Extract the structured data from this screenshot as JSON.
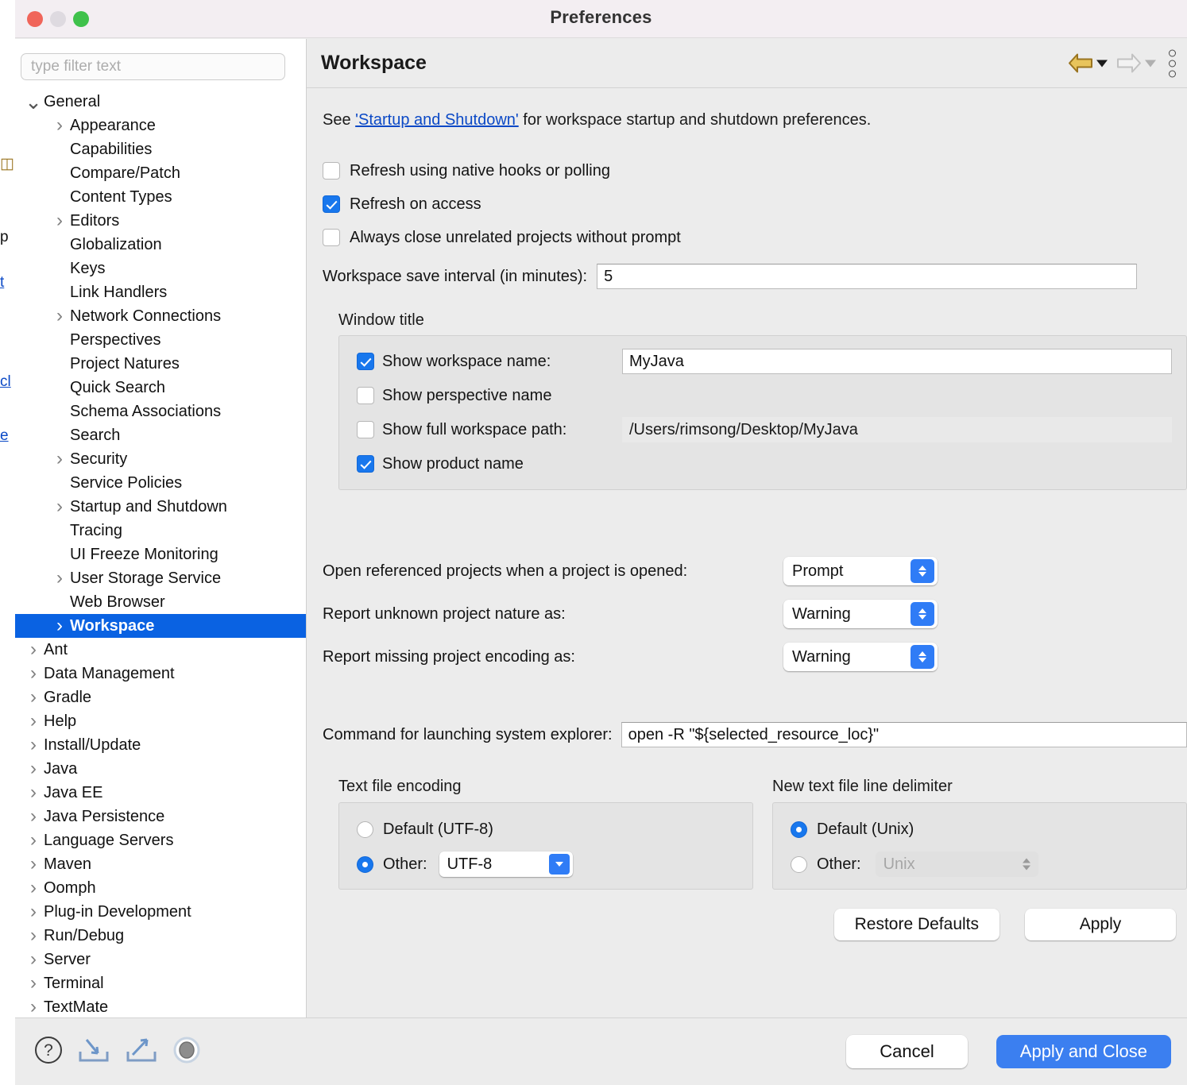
{
  "background_window": {
    "fragments": [
      "p",
      "t",
      "cl",
      "e"
    ]
  },
  "window": {
    "title": "Preferences",
    "traffic_lights": {
      "close": "close-button",
      "minimize": "minimize-button",
      "maximize": "maximize-button"
    }
  },
  "sidebar": {
    "filter": {
      "placeholder": "type filter text",
      "value": ""
    },
    "items": [
      {
        "label": "General",
        "indent": 0,
        "twisty": "down",
        "selected": false
      },
      {
        "label": "Appearance",
        "indent": 1,
        "twisty": "right",
        "selected": false
      },
      {
        "label": "Capabilities",
        "indent": 1,
        "twisty": "none",
        "selected": false
      },
      {
        "label": "Compare/Patch",
        "indent": 1,
        "twisty": "none",
        "selected": false
      },
      {
        "label": "Content Types",
        "indent": 1,
        "twisty": "none",
        "selected": false
      },
      {
        "label": "Editors",
        "indent": 1,
        "twisty": "right",
        "selected": false
      },
      {
        "label": "Globalization",
        "indent": 1,
        "twisty": "none",
        "selected": false
      },
      {
        "label": "Keys",
        "indent": 1,
        "twisty": "none",
        "selected": false
      },
      {
        "label": "Link Handlers",
        "indent": 1,
        "twisty": "none",
        "selected": false
      },
      {
        "label": "Network Connections",
        "indent": 1,
        "twisty": "right",
        "selected": false
      },
      {
        "label": "Perspectives",
        "indent": 1,
        "twisty": "none",
        "selected": false
      },
      {
        "label": "Project Natures",
        "indent": 1,
        "twisty": "none",
        "selected": false
      },
      {
        "label": "Quick Search",
        "indent": 1,
        "twisty": "none",
        "selected": false
      },
      {
        "label": "Schema Associations",
        "indent": 1,
        "twisty": "none",
        "selected": false
      },
      {
        "label": "Search",
        "indent": 1,
        "twisty": "none",
        "selected": false
      },
      {
        "label": "Security",
        "indent": 1,
        "twisty": "right",
        "selected": false
      },
      {
        "label": "Service Policies",
        "indent": 1,
        "twisty": "none",
        "selected": false
      },
      {
        "label": "Startup and Shutdown",
        "indent": 1,
        "twisty": "right",
        "selected": false
      },
      {
        "label": "Tracing",
        "indent": 1,
        "twisty": "none",
        "selected": false
      },
      {
        "label": "UI Freeze Monitoring",
        "indent": 1,
        "twisty": "none",
        "selected": false
      },
      {
        "label": "User Storage Service",
        "indent": 1,
        "twisty": "right",
        "selected": false
      },
      {
        "label": "Web Browser",
        "indent": 1,
        "twisty": "none",
        "selected": false
      },
      {
        "label": "Workspace",
        "indent": 1,
        "twisty": "right",
        "selected": true
      },
      {
        "label": "Ant",
        "indent": 0,
        "twisty": "right",
        "selected": false
      },
      {
        "label": "Data Management",
        "indent": 0,
        "twisty": "right",
        "selected": false
      },
      {
        "label": "Gradle",
        "indent": 0,
        "twisty": "right",
        "selected": false
      },
      {
        "label": "Help",
        "indent": 0,
        "twisty": "right",
        "selected": false
      },
      {
        "label": "Install/Update",
        "indent": 0,
        "twisty": "right",
        "selected": false
      },
      {
        "label": "Java",
        "indent": 0,
        "twisty": "right",
        "selected": false
      },
      {
        "label": "Java EE",
        "indent": 0,
        "twisty": "right",
        "selected": false
      },
      {
        "label": "Java Persistence",
        "indent": 0,
        "twisty": "right",
        "selected": false
      },
      {
        "label": "Language Servers",
        "indent": 0,
        "twisty": "right",
        "selected": false
      },
      {
        "label": "Maven",
        "indent": 0,
        "twisty": "right",
        "selected": false
      },
      {
        "label": "Oomph",
        "indent": 0,
        "twisty": "right",
        "selected": false
      },
      {
        "label": "Plug-in Development",
        "indent": 0,
        "twisty": "right",
        "selected": false
      },
      {
        "label": "Run/Debug",
        "indent": 0,
        "twisty": "right",
        "selected": false
      },
      {
        "label": "Server",
        "indent": 0,
        "twisty": "right",
        "selected": false
      },
      {
        "label": "Terminal",
        "indent": 0,
        "twisty": "right",
        "selected": false
      },
      {
        "label": "TextMate",
        "indent": 0,
        "twisty": "right",
        "selected": false
      }
    ]
  },
  "main": {
    "page_title": "Workspace",
    "nav": {
      "back_icon": "back-arrow-icon",
      "back_enabled": true,
      "forward_icon": "forward-arrow-icon",
      "forward_enabled": false,
      "menu_icon": "vertical-dots-menu-icon",
      "back_color": "#e8c45c",
      "back_border_color": "#9a7420",
      "forward_color": "#f0f0f0",
      "forward_border_color": "#c2c2c2"
    },
    "intro": {
      "prefix": "See ",
      "link": "'Startup and Shutdown'",
      "suffix": " for workspace startup and shutdown preferences."
    },
    "checkboxes": [
      {
        "label": "Refresh using native hooks or polling",
        "checked": false
      },
      {
        "label": "Refresh on access",
        "checked": true
      },
      {
        "label": "Always close unrelated projects without prompt",
        "checked": false
      }
    ],
    "save_interval": {
      "label": "Workspace save interval (in minutes):",
      "value": "5"
    },
    "window_title_group": {
      "title": "Window title",
      "rows": [
        {
          "label": "Show workspace name:",
          "checked": true,
          "has_field": true,
          "value": "MyJava",
          "readonly": false
        },
        {
          "label": "Show perspective name",
          "checked": false,
          "has_field": false,
          "value": "",
          "readonly": false
        },
        {
          "label": "Show full workspace path:",
          "checked": false,
          "has_field": true,
          "value": "/Users/rimsong/Desktop/MyJava",
          "readonly": true
        },
        {
          "label": "Show product name",
          "checked": true,
          "has_field": false,
          "value": "",
          "readonly": false
        }
      ]
    },
    "selects": [
      {
        "label": "Open referenced projects when a project is opened:",
        "value": "Prompt"
      },
      {
        "label": "Report unknown project nature as:",
        "value": "Warning"
      },
      {
        "label": "Report missing project encoding as:",
        "value": "Warning"
      }
    ],
    "command": {
      "label": "Command for launching system explorer:",
      "value": "open -R \"${selected_resource_loc}\""
    },
    "text_file_encoding": {
      "title": "Text file encoding",
      "default_label": "Default (UTF-8)",
      "default_selected": false,
      "other_label": "Other:",
      "other_selected": true,
      "other_value": "UTF-8"
    },
    "line_delimiter": {
      "title": "New text file line delimiter",
      "default_label": "Default (Unix)",
      "default_selected": true,
      "other_label": "Other:",
      "other_selected": false,
      "other_value": "Unix",
      "other_disabled": true
    },
    "actions": {
      "restore_defaults": "Restore Defaults",
      "apply": "Apply"
    }
  },
  "footer": {
    "icons": [
      {
        "name": "help-icon"
      },
      {
        "name": "import-preferences-icon"
      },
      {
        "name": "export-preferences-icon"
      },
      {
        "name": "status-indicator-icon"
      }
    ],
    "cancel": "Cancel",
    "apply_and_close": "Apply and Close",
    "primary_color": "#3b7ff0"
  }
}
